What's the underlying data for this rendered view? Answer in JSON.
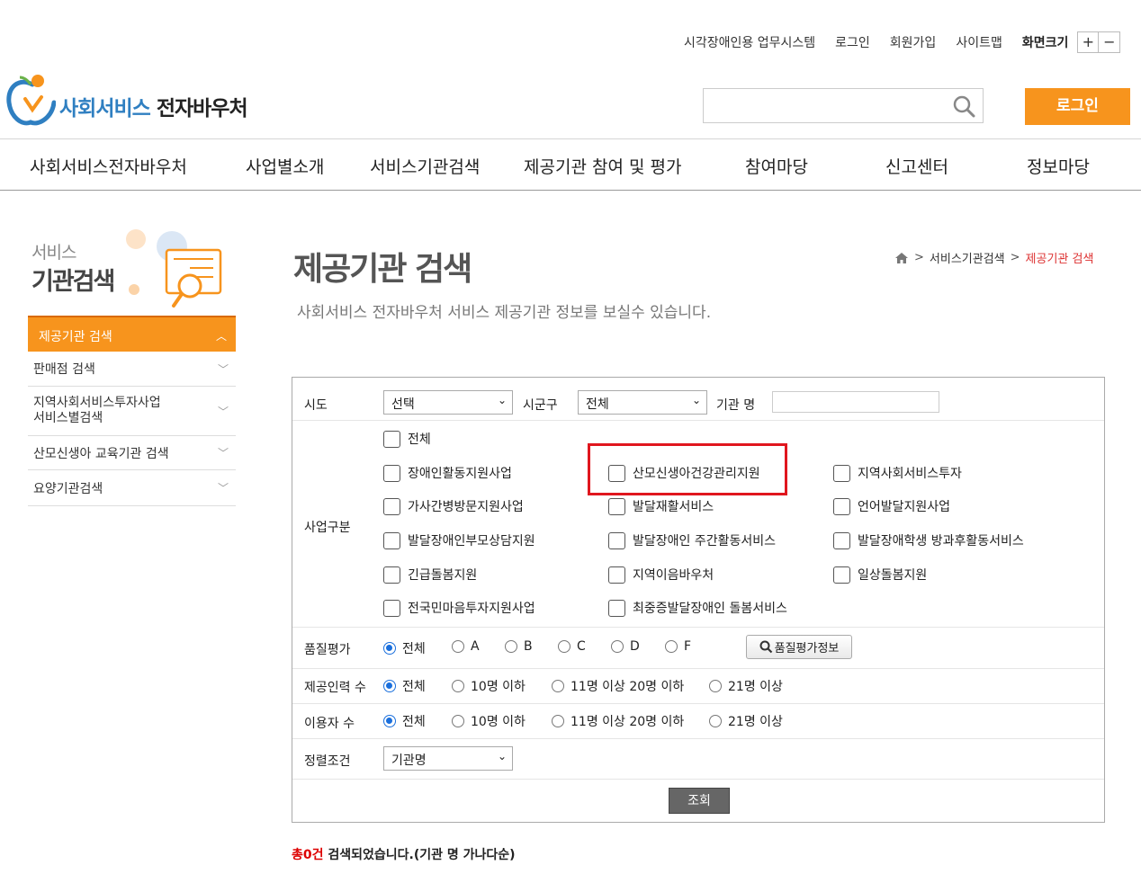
{
  "util": {
    "links": [
      "시각장애인용 업무시스템",
      "로그인",
      "회원가입",
      "사이트맵"
    ],
    "font_label": "화면크기",
    "plus": "+",
    "minus": "−"
  },
  "logo": {
    "part1": "사회서비스",
    "part2": "전자바우처"
  },
  "search": {
    "placeholder": "",
    "value": ""
  },
  "header": {
    "login_label": "로그인"
  },
  "gnb": [
    "사회서비스전자바우처",
    "사업별소개",
    "서비스기관검색",
    "제공기관 참여 및 평가",
    "참여마당",
    "신고센터",
    "정보마당"
  ],
  "sidebar": {
    "title_small": "서비스",
    "title_big": "기관검색",
    "active": "제공기관 검색",
    "items": [
      {
        "label": "판매점 검색"
      },
      {
        "label1": "지역사회서비스투자사업",
        "label2": "서비스별검색"
      },
      {
        "label": "산모신생아 교육기관 검색"
      },
      {
        "label": "요양기관검색"
      }
    ]
  },
  "main": {
    "title": "제공기관 검색",
    "subtitle": "사회서비스 전자바우처 서비스 제공기관 정보를 보실수 있습니다.",
    "breadcrumb": [
      "서비스기관검색",
      "제공기관 검색"
    ]
  },
  "form": {
    "sido_label": "시도",
    "sido_value": "선택",
    "sigungu_label": "시군구",
    "sigungu_value": "전체",
    "org_label": "기관 명",
    "org_value": "",
    "biz_label": "사업구분",
    "biz_all": "전체",
    "biz_items": [
      "장애인활동지원사업",
      "산모신생아건강관리지원",
      "지역사회서비스투자",
      "가사간병방문지원사업",
      "발달재활서비스",
      "언어발달지원사업",
      "발달장애인부모상담지원",
      "발달장애인 주간활동서비스",
      "발달장애학생 방과후활동서비스",
      "긴급돌봄지원",
      "지역이음바우처",
      "일상돌봄지원",
      "전국민마음투자지원사업",
      "최중증발달장애인 돌봄서비스"
    ],
    "quality_label": "품질평가",
    "quality_options": [
      "전체",
      "A",
      "B",
      "C",
      "D",
      "F"
    ],
    "quality_button": "품질평가정보",
    "staff_label": "제공인력 수",
    "staff_options": [
      "전체",
      "10명 이하",
      "11명 이상 20명 이하",
      "21명 이상"
    ],
    "users_label": "이용자 수",
    "users_options": [
      "전체",
      "10명 이하",
      "11명 이상 20명 이하",
      "21명 이상"
    ],
    "sort_label": "정렬조건",
    "sort_value": "기관명",
    "submit": "조회"
  },
  "result": {
    "count": "총0건",
    "text": " 검색되었습니다.(기관 명 가나다순)"
  },
  "colors": {
    "accent": "#f7941d",
    "highlight": "#e0161e",
    "radio": "#1a6fdc"
  }
}
